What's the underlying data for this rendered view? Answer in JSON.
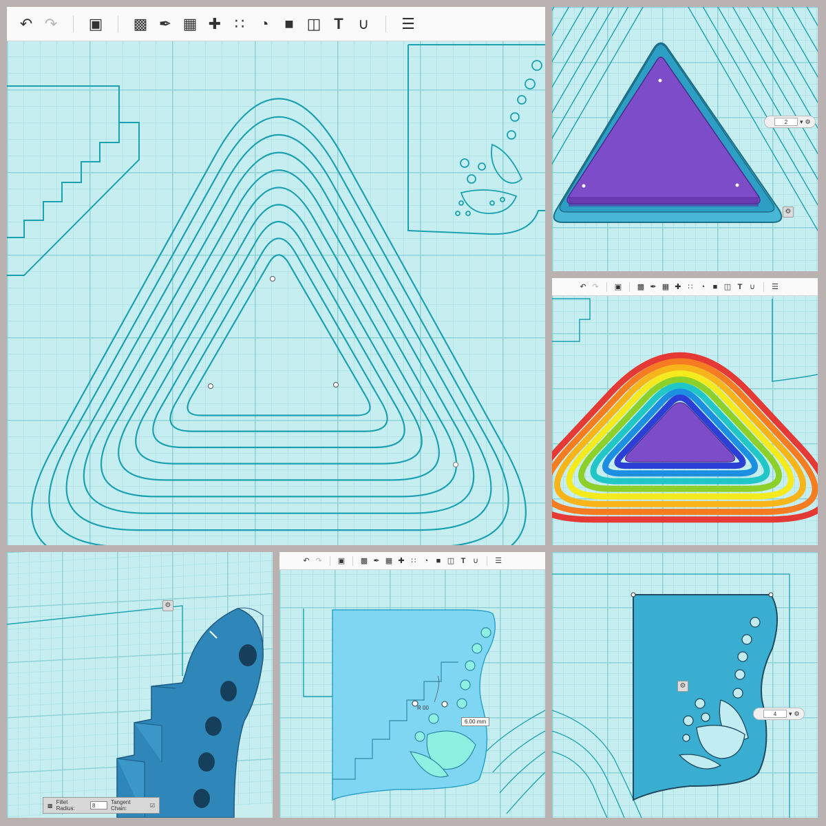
{
  "toolbar": {
    "undo_icon": "undo-arrow",
    "redo_icon": "redo-arrow",
    "tools": [
      "add-primitive",
      "extrude",
      "sweep",
      "revolve",
      "pattern",
      "snap",
      "combine",
      "shell",
      "split",
      "text",
      "measure",
      "materials"
    ],
    "text_tool_label": "T"
  },
  "panels": {
    "top_right": {
      "spinner_value": "2"
    },
    "bottom_left": {
      "fillet_label": "Fillet Radius:",
      "fillet_value": "8",
      "tangent_label": "Tangent Chain:"
    },
    "bottom_middle": {
      "dimension_value": "6.00 mm",
      "radius_label": "R 00"
    },
    "bottom_right": {
      "spinner_value": "4"
    }
  },
  "colors": {
    "grid_bg": "#c6eef0",
    "sketch_line": "#1aa0b0",
    "solid_blue": "#3fa8cc",
    "purple": "#7d4cc9",
    "rainbow": [
      "#e53935",
      "#f57c20",
      "#f7b51a",
      "#f4ea1e",
      "#8ed02a",
      "#21c7c7",
      "#1c8fe0",
      "#2b3fd6"
    ]
  }
}
